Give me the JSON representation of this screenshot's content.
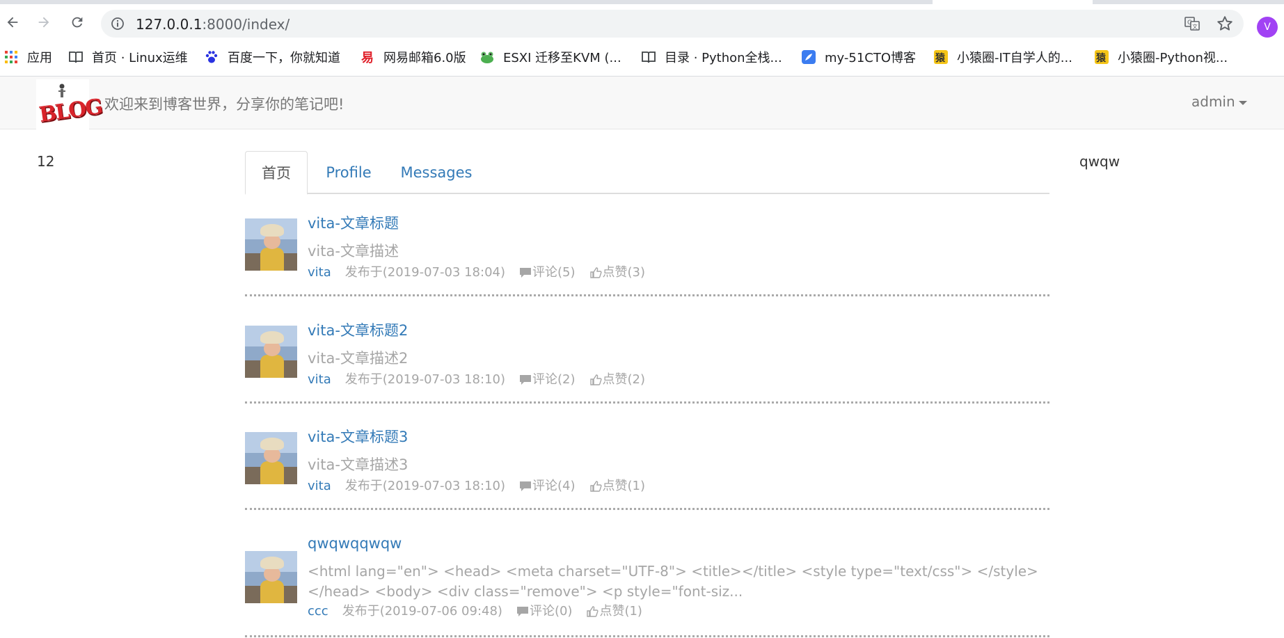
{
  "browser": {
    "url_host": "127.0.0.1",
    "url_rest": ":8000/index/",
    "profile_initial": "V",
    "bookmarks": [
      {
        "label": "应用",
        "icon": "apps-grid-icon"
      },
      {
        "label": "首页 · Linux运维",
        "icon": "book-icon"
      },
      {
        "label": "百度一下，你就知道",
        "icon": "baidu-paw-icon"
      },
      {
        "label": "网易邮箱6.0版",
        "icon": "netease-mail-icon"
      },
      {
        "label": "ESXI 迁移至KVM (...",
        "icon": "frog-icon"
      },
      {
        "label": "目录 · Python全栈...",
        "icon": "book-icon"
      },
      {
        "label": "my-51CTO博客",
        "icon": "feather-icon"
      },
      {
        "label": "小猿圈-IT自学人的...",
        "icon": "yuan-icon"
      },
      {
        "label": "小猿圈-Python视...",
        "icon": "yuan-icon"
      }
    ],
    "colors": {
      "accent": "#1a73e8",
      "avatar": "#a142f4"
    }
  },
  "site": {
    "logo_text": "BLOG",
    "tagline": "欢迎来到博客世界，分享你的笔记吧!",
    "user_menu": "admin",
    "left_column": "12",
    "right_column": "qwqw"
  },
  "tabs": [
    {
      "label": "首页",
      "active": true
    },
    {
      "label": "Profile",
      "active": false
    },
    {
      "label": "Messages",
      "active": false
    }
  ],
  "articles": [
    {
      "title": "vita-文章标题",
      "desc": "vita-文章描述",
      "author": "vita",
      "date": "发布于(2019-07-03 18:04)",
      "comments": "评论(5)",
      "likes": "点赞(3)"
    },
    {
      "title": "vita-文章标题2",
      "desc": "vita-文章描述2",
      "author": "vita",
      "date": "发布于(2019-07-03 18:10)",
      "comments": "评论(2)",
      "likes": "点赞(2)"
    },
    {
      "title": "vita-文章标题3",
      "desc": "vita-文章描述3",
      "author": "vita",
      "date": "发布于(2019-07-03 18:10)",
      "comments": "评论(4)",
      "likes": "点赞(1)"
    },
    {
      "title": "qwqwqqwqw",
      "desc": "<html lang=\"en\"> <head> <meta charset=\"UTF-8\"> <title></title> <style type=\"text/css\"> </style> </head> <body> <div class=\"remove\"> <p style=\"font-siz...",
      "author": "ccc",
      "date": "发布于(2019-07-06 09:48)",
      "comments": "评论(0)",
      "likes": "点赞(1)"
    }
  ],
  "colors": {
    "link": "#337ab7",
    "muted": "#a6a6a6",
    "navbar_bg": "#f8f8f8"
  }
}
